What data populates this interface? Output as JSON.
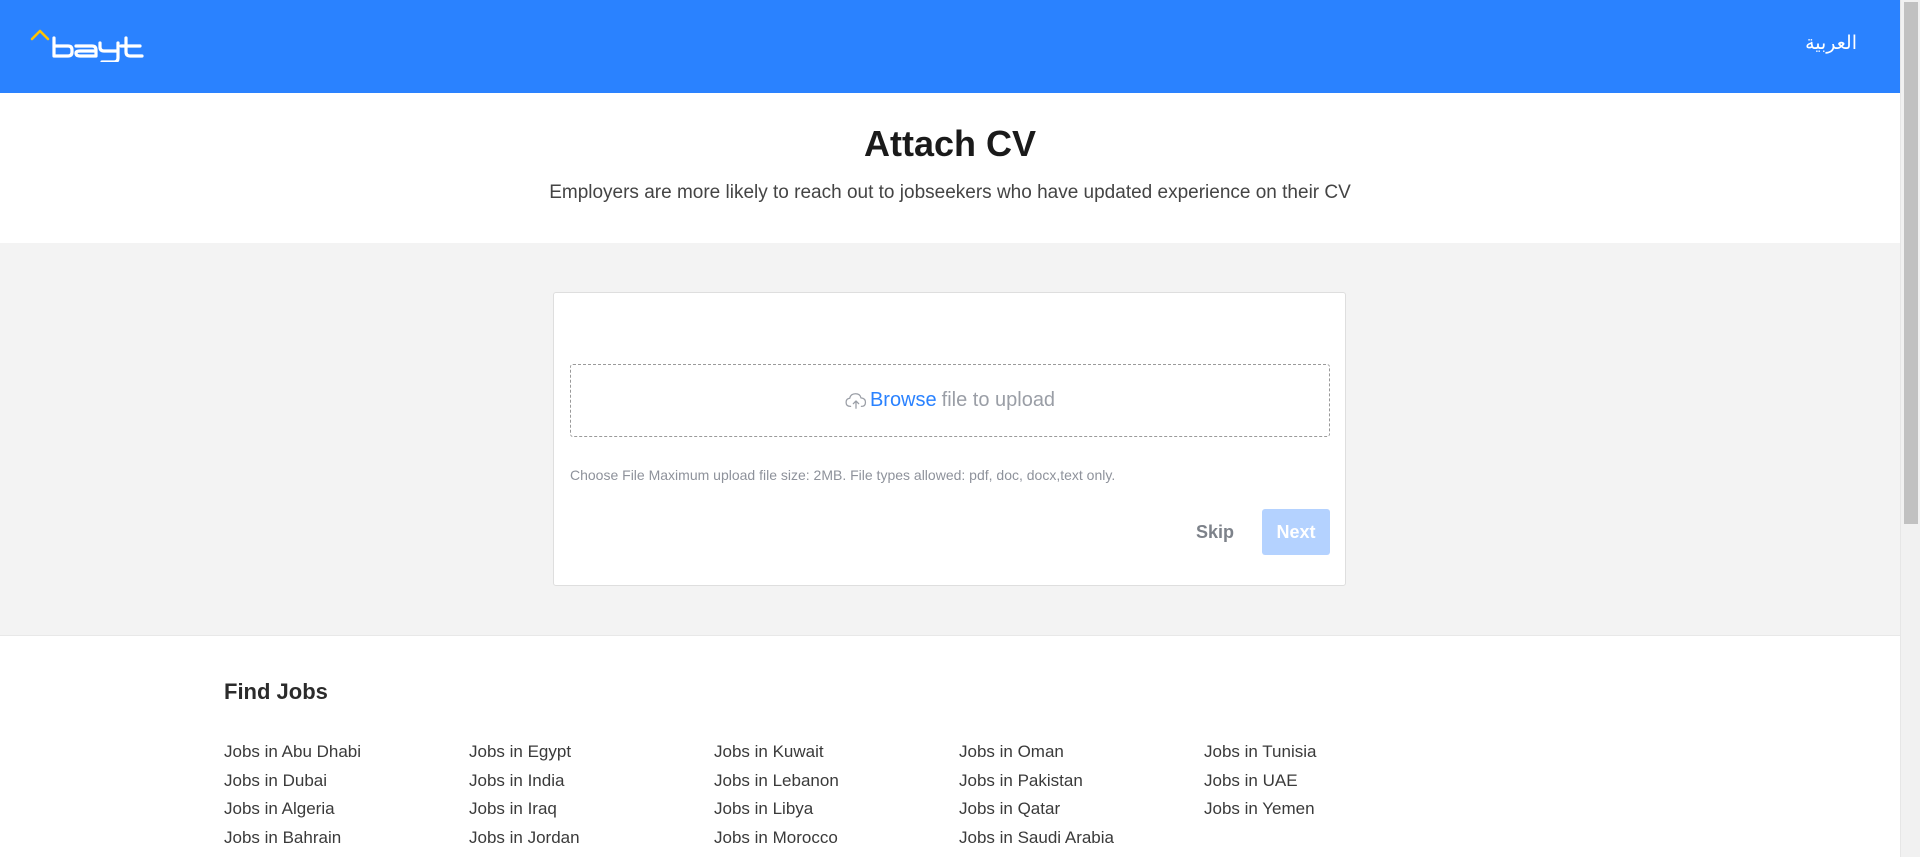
{
  "header": {
    "logo_text": "bayt",
    "language_link": "العربية",
    "colors": {
      "bar": "#2a82ff",
      "logo_accent": "#ffc400"
    }
  },
  "page": {
    "title": "Attach CV",
    "subtitle": "Employers are more likely to reach out to jobseekers who have updated experience on their CV"
  },
  "upload": {
    "icon": "cloud-upload-icon",
    "browse_label": "Browse",
    "dropzone_text": "file to upload",
    "hint": "Choose File Maximum upload file size: 2MB. File types allowed: pdf, doc, docx,text only.",
    "skip_label": "Skip",
    "next_label": "Next"
  },
  "footer": {
    "title": "Find Jobs",
    "columns": [
      [
        "Jobs in Abu Dhabi",
        "Jobs in Dubai",
        "Jobs in Algeria",
        "Jobs in Bahrain"
      ],
      [
        "Jobs in Egypt",
        "Jobs in India",
        "Jobs in Iraq",
        "Jobs in Jordan"
      ],
      [
        "Jobs in Kuwait",
        "Jobs in Lebanon",
        "Jobs in Libya",
        "Jobs in Morocco"
      ],
      [
        "Jobs in Oman",
        "Jobs in Pakistan",
        "Jobs in Qatar",
        "Jobs in Saudi Arabia"
      ],
      [
        "Jobs in Tunisia",
        "Jobs in UAE",
        "Jobs in Yemen"
      ]
    ]
  }
}
